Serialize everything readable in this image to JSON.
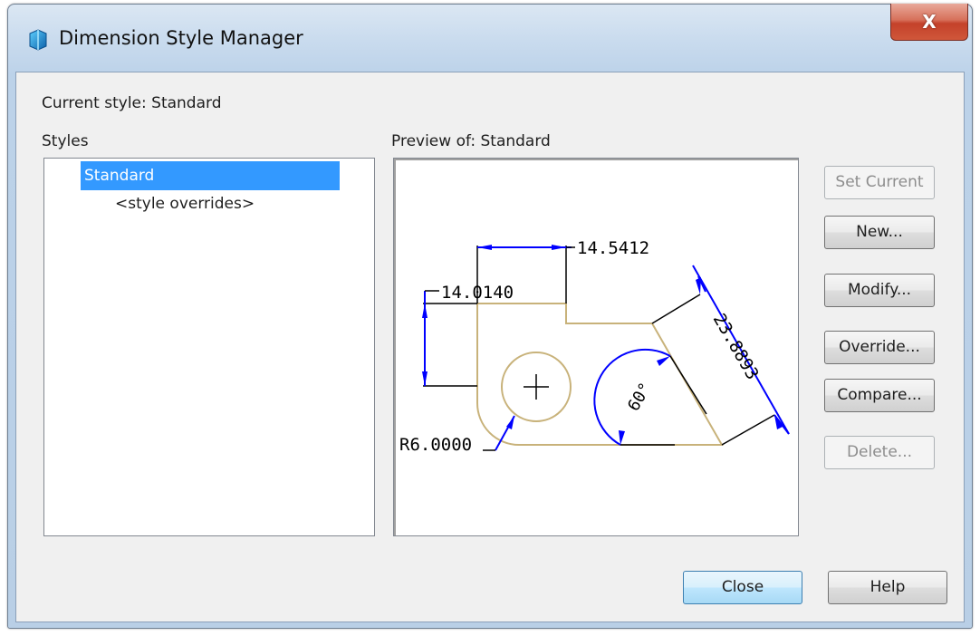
{
  "window": {
    "title": "Dimension Style Manager",
    "close_symbol": "X"
  },
  "current_style": "Current style: Standard",
  "styles": {
    "label": "Styles",
    "items": [
      {
        "label": "Standard",
        "selected": true
      },
      {
        "label": "<style overrides>",
        "selected": false
      }
    ]
  },
  "preview": {
    "label": "Preview of: Standard",
    "annotations": {
      "top_dim": "14.5412",
      "left_dim": "14.0140",
      "diag_dim": "23.8893",
      "angle_dim": "60°",
      "radius_dim": "R6.0000"
    }
  },
  "buttons": {
    "set_current": "Set Current",
    "new": "New...",
    "modify": "Modify...",
    "override": "Override...",
    "compare": "Compare...",
    "delete": "Delete...",
    "close": "Close",
    "help": "Help"
  },
  "colors": {
    "selection": "#3399ff",
    "dimension_line": "#0000ff",
    "geometry": "#c8b27a"
  }
}
